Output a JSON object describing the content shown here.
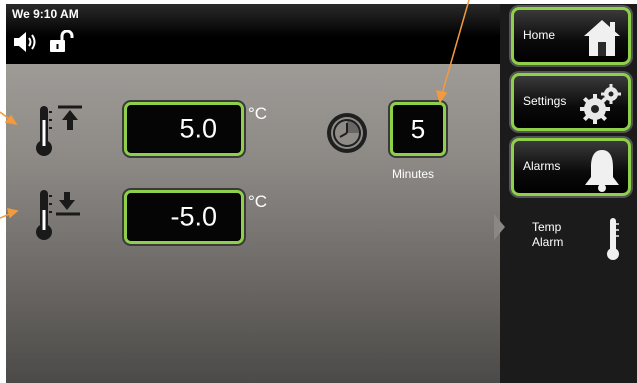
{
  "status": {
    "clock": "We 9:10 AM",
    "speaker_icon": "speaker-icon",
    "lock_icon": "unlock-icon"
  },
  "temperature": {
    "high_limit": {
      "icon": "thermometer-high-icon",
      "value": "5.0",
      "unit": "°C"
    },
    "low_limit": {
      "icon": "thermometer-low-icon",
      "value": "-5.0",
      "unit": "°C"
    }
  },
  "delay": {
    "icon": "timer-icon",
    "value": "5",
    "label": "Minutes"
  },
  "nav": {
    "home_label": "Home",
    "settings_label": "Settings",
    "alarms_label": "Alarms",
    "current_line1": "Temp",
    "current_line2": "Alarm"
  },
  "colors": {
    "accent": "#8ed04a",
    "annotation": "#f39a3c",
    "panel_top": "#9e9b97",
    "panel_bottom": "#4c4a48"
  }
}
